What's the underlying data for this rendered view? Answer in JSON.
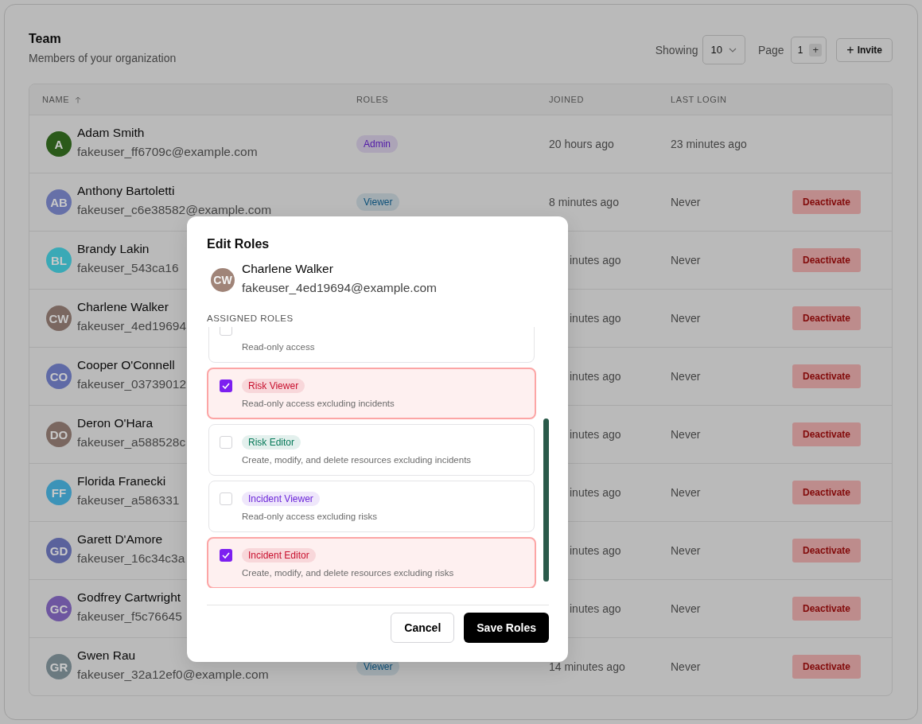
{
  "header": {
    "title": "Team",
    "subtitle": "Members of your organization",
    "showing_label": "Showing",
    "page_size": "10",
    "page_label": "Page",
    "page": "1",
    "page_step": "+",
    "invite_button": {
      "icon": "+",
      "label": "Invite"
    }
  },
  "table": {
    "columns": [
      {
        "label": "NAME",
        "sorted": true
      },
      {
        "label": "ROLES",
        "sorted": false
      },
      {
        "label": "JOINED",
        "sorted": false
      },
      {
        "label": "LAST LOGIN",
        "sorted": false
      }
    ],
    "rows": [
      {
        "initials": "A",
        "color": "#2b5a1a",
        "name": "Adam Smith",
        "email": "fakeuser_ff6709c@example.com",
        "role": {
          "label": "Admin",
          "color": "#5018a8"
        },
        "joined": "20 hours ago",
        "joined_cut": false,
        "last_login": "23 minutes ago"
      },
      {
        "initials": "AB",
        "color": "#6670a8",
        "name": "Anthony Bartoletti",
        "email": "fakeuser_c6e38582@example.com",
        "role": {
          "label": "Viewer",
          "color": "#0b4f78"
        },
        "joined": "8 minutes ago",
        "joined_cut": false,
        "last_login": "Never",
        "action": "Deactivate"
      },
      {
        "initials": "BL",
        "color": "#3aa9b6",
        "name": "Brandy Lakin",
        "email": "fakeuser_543ca16",
        "joined": "inutes ago",
        "joined_cut": true,
        "last_login": "Never",
        "action": "Deactivate"
      },
      {
        "initials": "CW",
        "color": "#7a6760",
        "name": "Charlene Walker",
        "email": "fakeuser_4ed19694",
        "joined": "inutes ago",
        "joined_cut": true,
        "last_login": "Never",
        "action": "Deactivate"
      },
      {
        "initials": "CO",
        "color": "#5f6aa6",
        "name": "Cooper O'Connell",
        "email": "fakeuser_03739012",
        "joined": "inutes ago",
        "joined_cut": true,
        "last_login": "Never",
        "action": "Deactivate"
      },
      {
        "initials": "DO",
        "color": "#7a6760",
        "name": "Deron O'Hara",
        "email": "fakeuser_a588528c",
        "joined": "inutes ago",
        "joined_cut": true,
        "last_login": "Never",
        "action": "Deactivate"
      },
      {
        "initials": "FF",
        "color": "#3c93b8",
        "name": "Florida Franecki",
        "email": "fakeuser_a586331",
        "joined": "inutes ago",
        "joined_cut": true,
        "last_login": "Never",
        "action": "Deactivate"
      },
      {
        "initials": "GD",
        "color": "#5a629c",
        "name": "Garett D'Amore",
        "email": "fakeuser_16c34c3a",
        "joined": "inutes ago",
        "joined_cut": true,
        "last_login": "Never",
        "action": "Deactivate"
      },
      {
        "initials": "GC",
        "color": "#6e56a0",
        "name": "Godfrey Cartwright",
        "email": "fakeuser_f5c76645",
        "joined": "inutes ago",
        "joined_cut": true,
        "last_login": "Never",
        "action": "Deactivate"
      },
      {
        "initials": "GR",
        "color": "#6b7a80",
        "name": "Gwen Rau",
        "email": "fakeuser_32a12ef0@example.com",
        "role": {
          "label": "Viewer",
          "color": "#0b4f78"
        },
        "joined": "14 minutes ago",
        "joined_cut": false,
        "last_login": "Never",
        "action": "Deactivate"
      }
    ]
  },
  "dialog": {
    "title": "Edit Roles",
    "user": {
      "initials": "CW",
      "color": "#a08478",
      "name": "Charlene Walker",
      "email": "fakeuser_4ed19694@example.com"
    },
    "section_label": "ASSIGNED ROLES",
    "roles": [
      {
        "checked": false,
        "description": "Read-only access"
      },
      {
        "checked": true,
        "label": "Risk Viewer",
        "color": "#c8102e",
        "description": "Read-only access excluding incidents"
      },
      {
        "checked": false,
        "label": "Risk Editor",
        "color": "#047857",
        "description": "Create, modify, and delete resources excluding incidents"
      },
      {
        "checked": false,
        "label": "Incident Viewer",
        "color": "#6d28d9",
        "description": "Read-only access excluding risks"
      },
      {
        "checked": true,
        "label": "Incident Editor",
        "color": "#c8102e",
        "description": "Create, modify, and delete resources excluding risks"
      }
    ],
    "buttons": [
      {
        "kind": "secondary",
        "label": "Cancel"
      },
      {
        "kind": "primary",
        "label": "Save Roles"
      }
    ]
  }
}
